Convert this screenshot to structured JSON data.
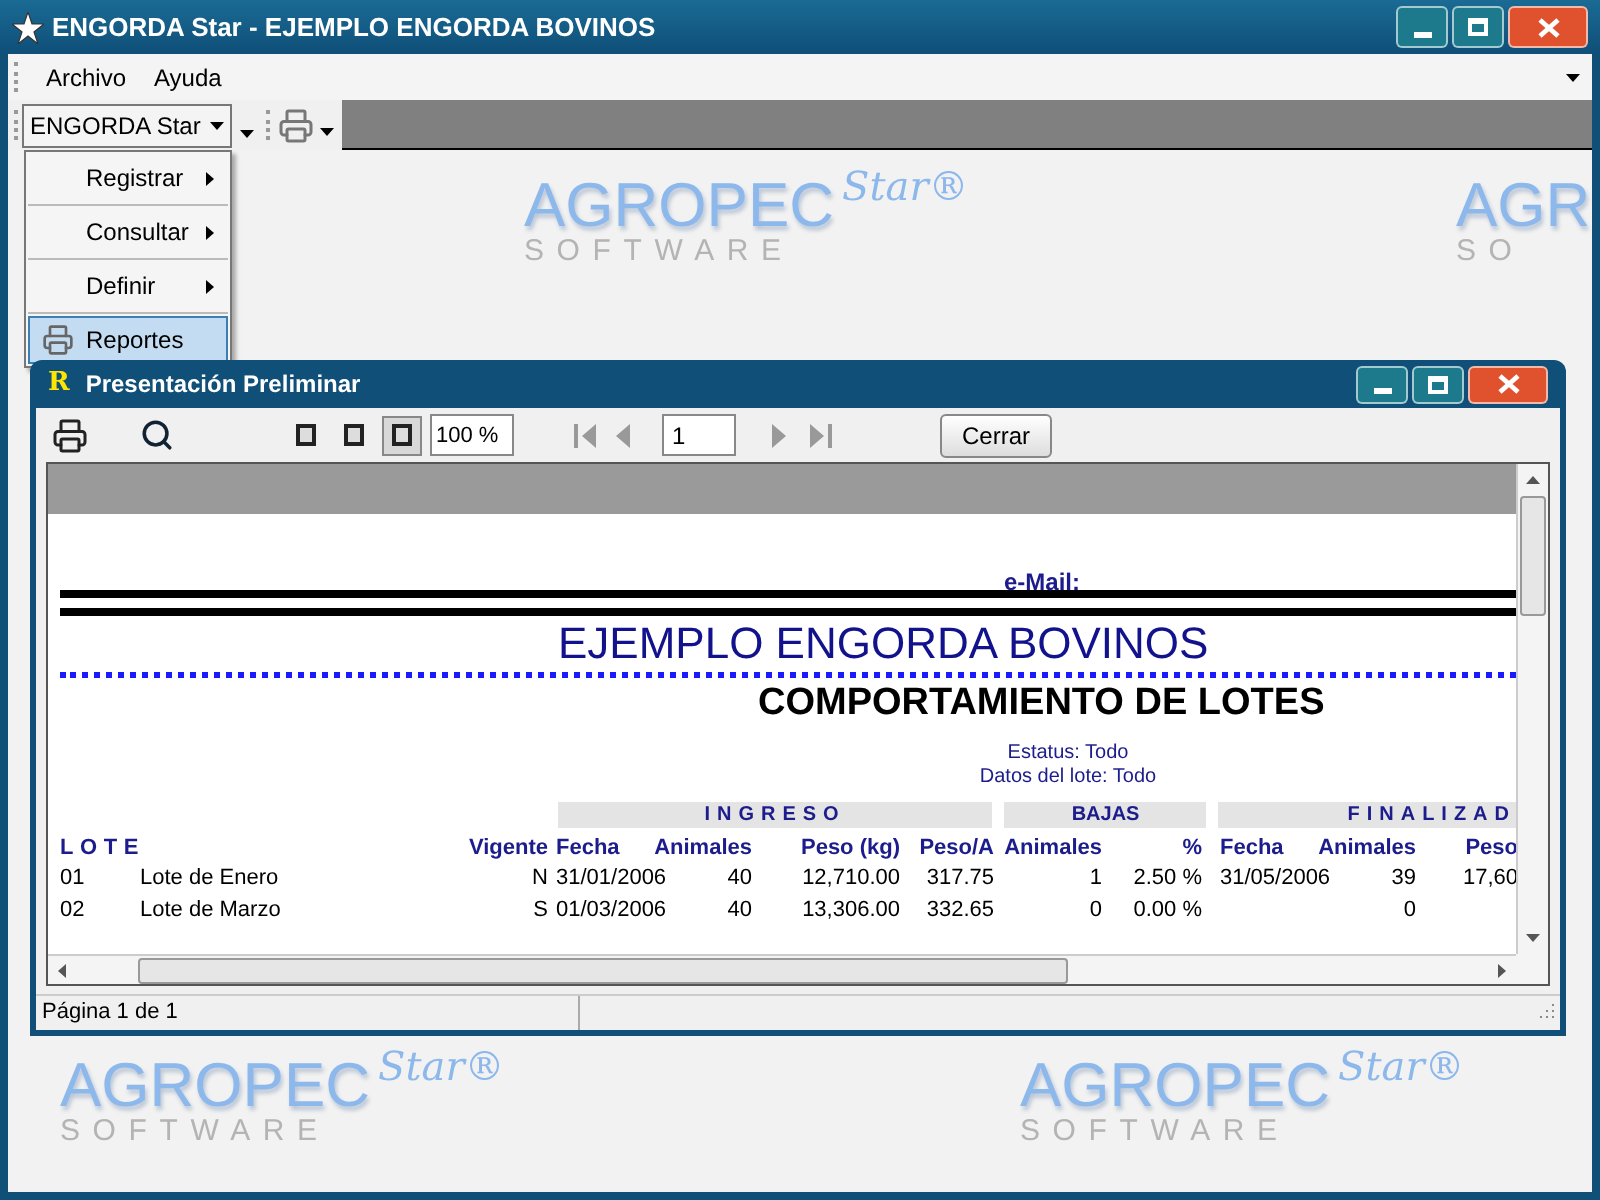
{
  "window": {
    "title": "ENGORDA Star - EJEMPLO ENGORDA BOVINOS"
  },
  "menu": [
    "Archivo",
    "Ayuda"
  ],
  "toolbar": {
    "dropdown_label": "ENGORDA Star"
  },
  "dropdown_menu": [
    {
      "label": "Registrar",
      "submenu": true,
      "selected": false
    },
    {
      "label": "Consultar",
      "submenu": true,
      "selected": false
    },
    {
      "label": "Definir",
      "submenu": true,
      "selected": false
    },
    {
      "label": "Reportes",
      "submenu": false,
      "selected": true
    }
  ],
  "background_logos": [
    {
      "brand": "AGROPEC",
      "script": "Star®",
      "tagline": "SOFTWARE"
    },
    {
      "brand": "AGR",
      "tagline": "SO"
    },
    {
      "brand": "AGROPEC",
      "script": "Star®",
      "tagline": "SOFTWARE"
    },
    {
      "brand": "AGROPEC",
      "script": "Star®",
      "tagline": "SOFTWARE"
    }
  ],
  "preview_window": {
    "icon_letter": "R",
    "title": "Presentación Preliminar",
    "view_buttons": [
      {
        "selected": false
      },
      {
        "selected": false
      },
      {
        "selected": true
      }
    ],
    "zoom": "100 %",
    "page": "1",
    "close_button": "Cerrar",
    "report": {
      "email_label": "e-Mail:",
      "company": "EJEMPLO ENGORDA BOVINOS",
      "title": "COMPORTAMIENTO DE LOTES",
      "filters": [
        "Estatus: Todo",
        "Datos del lote: Todo"
      ],
      "groups": [
        {
          "label": "INGRESO",
          "letter_spaced": true
        },
        {
          "label": "BAJAS",
          "letter_spaced": false
        },
        {
          "label": "FINALIZAD",
          "letter_spaced": true
        }
      ],
      "columns": [
        "LOTE",
        "",
        "Vigente",
        "Fecha",
        "Animales",
        "Peso (kg)",
        "Peso/A",
        "Animales",
        "%",
        "Fecha",
        "Animales",
        "Peso"
      ],
      "rows": [
        [
          "01",
          "Lote de Enero",
          "N",
          "31/01/2006",
          "40",
          "12,710.00",
          "317.75",
          "1",
          "2.50 %",
          "31/05/2006",
          "39",
          "17,60"
        ],
        [
          "02",
          "Lote de Marzo",
          "S",
          "01/03/2006",
          "40",
          "13,306.00",
          "332.65",
          "0",
          "0.00 %",
          "",
          "0",
          ""
        ]
      ]
    },
    "status": "Página 1 de 1"
  }
}
